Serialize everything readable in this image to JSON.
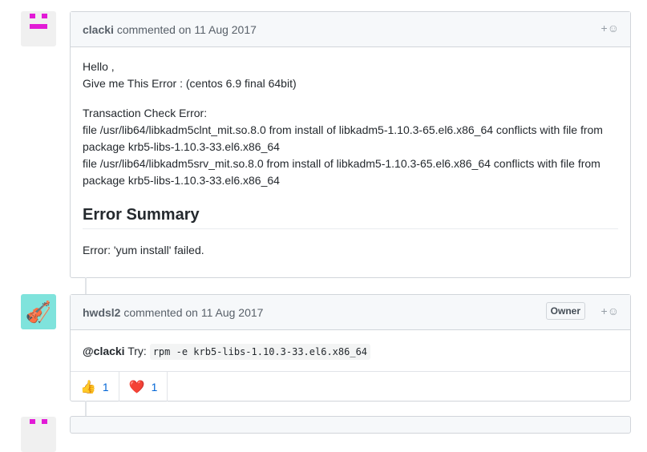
{
  "comments": [
    {
      "author": "clacki",
      "meta": "commented on 11 Aug 2017",
      "avatar_color": "#e21bd6",
      "lines": [
        "Hello ,",
        "Give me This Error : (centos 6.9 final 64bit)"
      ],
      "lines2": [
        "Transaction Check Error:",
        "file /usr/lib64/libkadm5clnt_mit.so.8.0 from install of libkadm5-1.10.3-65.el6.x86_64 conflicts with file from package krb5-libs-1.10.3-33.el6.x86_64",
        "file /usr/lib64/libkadm5srv_mit.so.8.0 from install of libkadm5-1.10.3-65.el6.x86_64 conflicts with file from package krb5-libs-1.10.3-33.el6.x86_64"
      ],
      "heading": "Error Summary",
      "footer": "Error: 'yum install' failed."
    },
    {
      "author": "hwdsl2",
      "meta": "commented on 11 Aug 2017",
      "badge": "Owner",
      "mention": "@clacki",
      "try": "Try:",
      "code": "rpm -e krb5-libs-1.10.3-33.el6.x86_64",
      "reactions": [
        {
          "icon": "thumbs-up",
          "emoji": "👍",
          "count": "1"
        },
        {
          "icon": "heart",
          "emoji": "❤️",
          "count": "1"
        }
      ]
    }
  ],
  "add_reaction": "+☺"
}
